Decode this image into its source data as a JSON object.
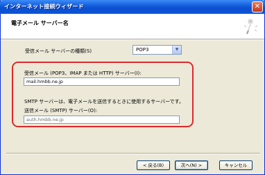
{
  "window": {
    "title": "インターネット接続ウィザード",
    "close_glyph": "✕"
  },
  "header": {
    "page_title": "電子メール サーバー名"
  },
  "form": {
    "server_type_label": "受信メール サーバーの種類(S)",
    "server_type_value": "POP3",
    "incoming_label": "受信メール (POP3、IMAP または HTTP) サーバー(I):",
    "incoming_value": "mail.hmbb.ne.jp",
    "smtp_note": "SMTP サーバーは、電子メールを送信するときに使用するサーバーです。",
    "outgoing_label": "送信メール (SMTP) サーバー(O):",
    "outgoing_value": "auth.hmbb.ne.jp",
    "highlight_color": "#e0282b"
  },
  "buttons": {
    "back": "< 戻る(B)",
    "next": "次へ(N) >",
    "cancel": "キャンセル"
  },
  "icons": {
    "wizard": "wizard-sparkle-icon",
    "dropdown": "chevron-down-icon"
  }
}
